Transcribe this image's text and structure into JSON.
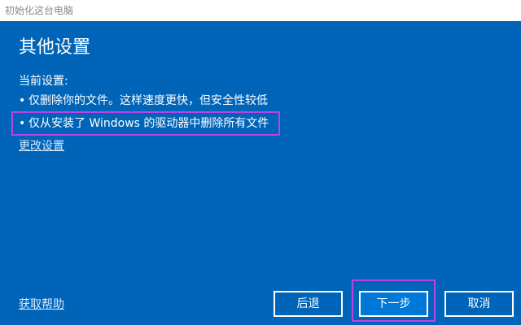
{
  "window": {
    "title": "初始化这台电脑"
  },
  "content": {
    "heading": "其他设置",
    "settings_label": "当前设置:",
    "bullets": [
      "仅删除你的文件。这样速度更快，但安全性较低",
      "仅从安装了 Windows 的驱动器中删除所有文件"
    ],
    "bullet_char": "•",
    "change_settings_link": "更改设置",
    "help_link": "获取帮助"
  },
  "buttons": {
    "back": "后退",
    "next": "下一步",
    "cancel": "取消"
  },
  "colors": {
    "background": "#0064b8",
    "highlight": "#c040e8",
    "text": "#ffffff"
  }
}
